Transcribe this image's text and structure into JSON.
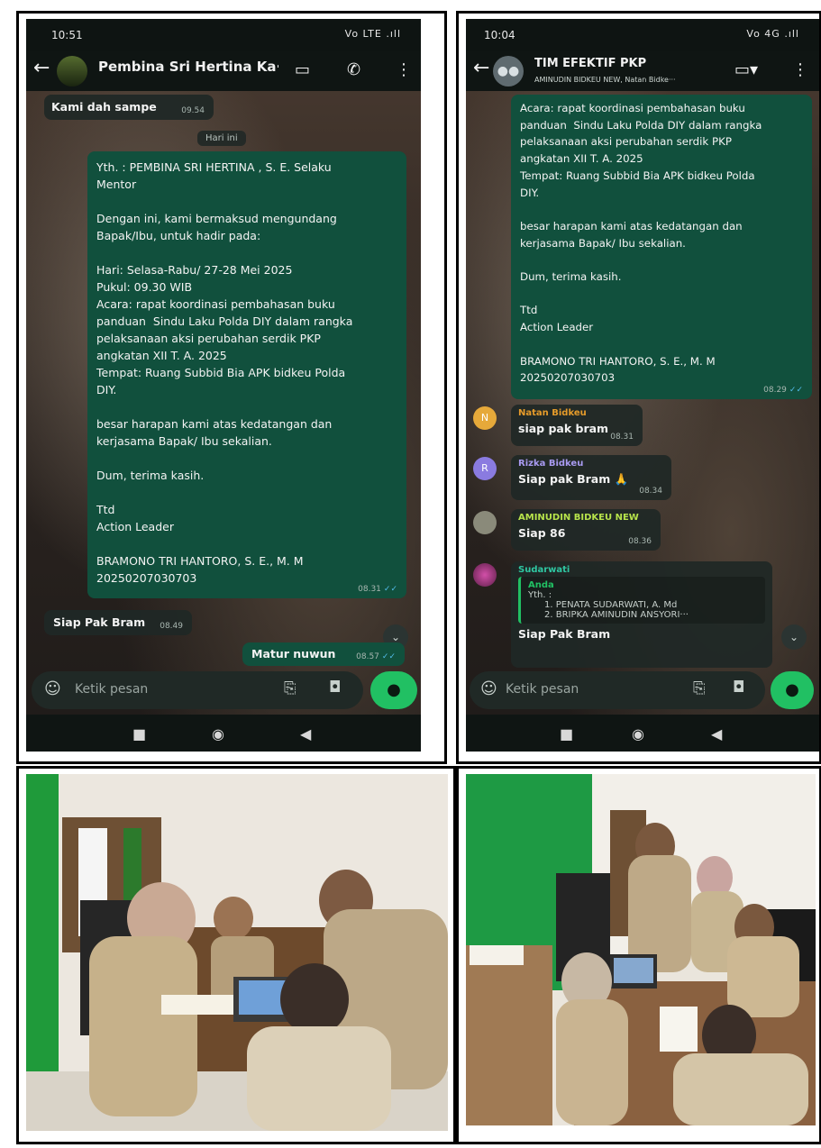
{
  "screen1": {
    "status_time": "10:51",
    "status_icons": "Vo LTE .ıll",
    "chat_title": "Pembina Sri Hertina Ka···",
    "prev_message": {
      "text": "Kami dah sampe",
      "time": "09.54"
    },
    "date_chip": "Hari ini",
    "invite_message": {
      "text": "Yth. : PEMBINA SRI HERTINA , S. E. Selaku\nMentor\n\nDengan ini, kami bermaksud mengundang\nBapak/Ibu, untuk hadir pada:\n\nHari: Selasa-Rabu/ 27-28 Mei 2025\nPukul: 09.30 WIB\nAcara: rapat koordinasi pembahasan buku\npanduan  Sindu Laku Polda DIY dalam rangka\npelaksanaan aksi perubahan serdik PKP\nangkatan XII T. A. 2025\nTempat: Ruang Subbid Bia APK bidkeu Polda\nDIY.\n\nbesar harapan kami atas kedatangan dan\nkerjasama Bapak/ Ibu sekalian.\n\nDum, terima kasih.\n\nTtd\nAction Leader\n\nBRAMONO TRI HANTORO, S. E., M. M\n20250207030703",
      "time": "08.31"
    },
    "reply_in": {
      "text": "Siap Pak Bram",
      "time": "08.49"
    },
    "reply_out": {
      "text": "Matur nuwun",
      "time": "08.57"
    },
    "input_placeholder": "Ketik pesan"
  },
  "screen2": {
    "status_time": "10:04",
    "status_icons": "Vo 4G .ıll",
    "chat_title": "TIM EFEKTIF PKP",
    "chat_subtitle": "AMINUDIN BIDKEU NEW, Natan Bidke···",
    "forward_message": {
      "text": "Acara: rapat koordinasi pembahasan buku\npanduan  Sindu Laku Polda DIY dalam rangka\npelaksanaan aksi perubahan serdik PKP\nangkatan XII T. A. 2025\nTempat: Ruang Subbid Bia APK bidkeu Polda\nDIY.\n\nbesar harapan kami atas kedatangan dan\nkerjasama Bapak/ Ibu sekalian.\n\nDum, terima kasih.\n\nTtd\nAction Leader\n\nBRAMONO TRI HANTORO, S. E., M. M\n20250207030703",
      "time": "08.29"
    },
    "group_messages": [
      {
        "sender": "Natan Bidkeu",
        "initial": "N",
        "text": "siap pak bram",
        "time": "08.31",
        "sender_color": "#e59b2a",
        "avatar_color": "#e6a93a"
      },
      {
        "sender": "Rizka Bidkeu",
        "initial": "R",
        "text": "Siap pak Bram 🙏",
        "time": "08.34",
        "sender_color": "#a99bf2",
        "avatar_color": "#8a7be0"
      },
      {
        "sender": "AMINUDIN BIDKEU NEW",
        "initial": "",
        "text": "Siap 86",
        "time": "08.36",
        "sender_color": "#b7e34b",
        "avatar_color": "#8a8a7a"
      }
    ],
    "quoted_message": {
      "sender": "Sudarwati",
      "sender_color": "#2fc7a2",
      "quote_author": "Anda",
      "quote_lines": [
        "Yth. :",
        "1. PENATA SUDARWATI, A. Md",
        "2. BRIPKA AMINUDIN ANSYORI···"
      ],
      "text": "Siap Pak Bram"
    },
    "input_placeholder": "Ketik pesan"
  }
}
